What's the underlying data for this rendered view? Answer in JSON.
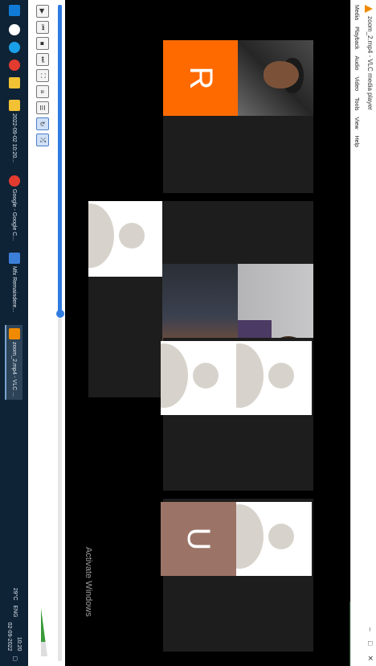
{
  "window": {
    "title": "zoom_2.mp4 - VLC media player",
    "controls": [
      "–",
      "□",
      "✕"
    ]
  },
  "menu": [
    "Media",
    "Playback",
    "Audio",
    "Video",
    "Tools",
    "View",
    "Help"
  ],
  "participants": [
    {
      "initial": "R",
      "color": "#ff6a00"
    },
    {
      "initial": "U",
      "color": "#9c7467"
    }
  ],
  "watermark": "Activate Windows",
  "player": {
    "progress": 0.47,
    "elapsed": "",
    "total": "",
    "volume_label": ""
  },
  "taskbar": {
    "items": [
      "2022-09-02 10:20...",
      "Google - Google C...",
      "Mfx Remaindere...",
      "zoom_2.mp4 - VLC ..."
    ],
    "tray": [
      "29°C",
      "ENG"
    ],
    "time": "10:20",
    "date": "02-09-2022"
  },
  "icons": [
    "vlc-cone-icon",
    "windows-start-icon",
    "search-icon",
    "edge-icon",
    "chrome-icon",
    "file-explorer-icon",
    "play-icon",
    "notification-icon"
  ]
}
